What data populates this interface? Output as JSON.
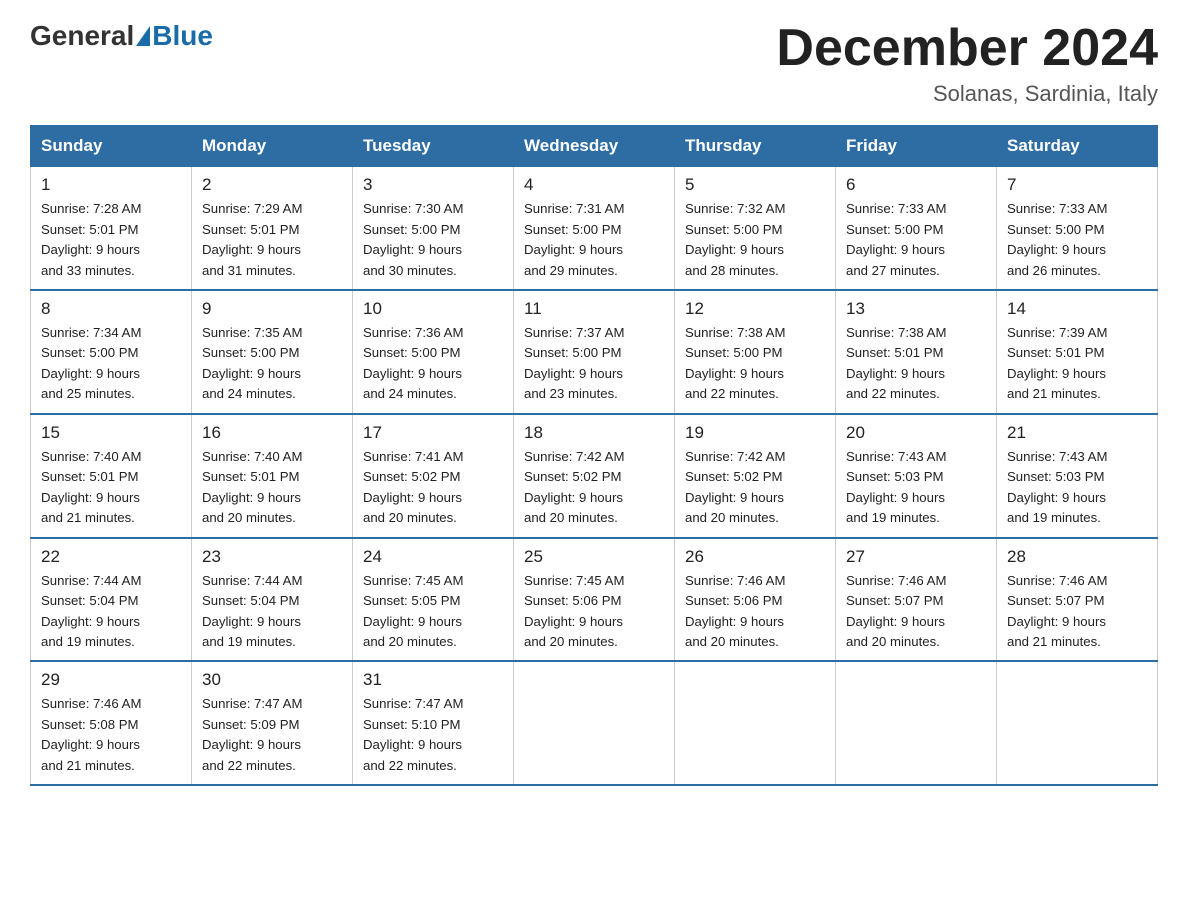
{
  "header": {
    "logo_general": "General",
    "logo_blue": "Blue",
    "month_title": "December 2024",
    "subtitle": "Solanas, Sardinia, Italy"
  },
  "days_of_week": [
    "Sunday",
    "Monday",
    "Tuesday",
    "Wednesday",
    "Thursday",
    "Friday",
    "Saturday"
  ],
  "weeks": [
    [
      {
        "day": "1",
        "sunrise": "7:28 AM",
        "sunset": "5:01 PM",
        "daylight": "9 hours and 33 minutes."
      },
      {
        "day": "2",
        "sunrise": "7:29 AM",
        "sunset": "5:01 PM",
        "daylight": "9 hours and 31 minutes."
      },
      {
        "day": "3",
        "sunrise": "7:30 AM",
        "sunset": "5:00 PM",
        "daylight": "9 hours and 30 minutes."
      },
      {
        "day": "4",
        "sunrise": "7:31 AM",
        "sunset": "5:00 PM",
        "daylight": "9 hours and 29 minutes."
      },
      {
        "day": "5",
        "sunrise": "7:32 AM",
        "sunset": "5:00 PM",
        "daylight": "9 hours and 28 minutes."
      },
      {
        "day": "6",
        "sunrise": "7:33 AM",
        "sunset": "5:00 PM",
        "daylight": "9 hours and 27 minutes."
      },
      {
        "day": "7",
        "sunrise": "7:33 AM",
        "sunset": "5:00 PM",
        "daylight": "9 hours and 26 minutes."
      }
    ],
    [
      {
        "day": "8",
        "sunrise": "7:34 AM",
        "sunset": "5:00 PM",
        "daylight": "9 hours and 25 minutes."
      },
      {
        "day": "9",
        "sunrise": "7:35 AM",
        "sunset": "5:00 PM",
        "daylight": "9 hours and 24 minutes."
      },
      {
        "day": "10",
        "sunrise": "7:36 AM",
        "sunset": "5:00 PM",
        "daylight": "9 hours and 24 minutes."
      },
      {
        "day": "11",
        "sunrise": "7:37 AM",
        "sunset": "5:00 PM",
        "daylight": "9 hours and 23 minutes."
      },
      {
        "day": "12",
        "sunrise": "7:38 AM",
        "sunset": "5:00 PM",
        "daylight": "9 hours and 22 minutes."
      },
      {
        "day": "13",
        "sunrise": "7:38 AM",
        "sunset": "5:01 PM",
        "daylight": "9 hours and 22 minutes."
      },
      {
        "day": "14",
        "sunrise": "7:39 AM",
        "sunset": "5:01 PM",
        "daylight": "9 hours and 21 minutes."
      }
    ],
    [
      {
        "day": "15",
        "sunrise": "7:40 AM",
        "sunset": "5:01 PM",
        "daylight": "9 hours and 21 minutes."
      },
      {
        "day": "16",
        "sunrise": "7:40 AM",
        "sunset": "5:01 PM",
        "daylight": "9 hours and 20 minutes."
      },
      {
        "day": "17",
        "sunrise": "7:41 AM",
        "sunset": "5:02 PM",
        "daylight": "9 hours and 20 minutes."
      },
      {
        "day": "18",
        "sunrise": "7:42 AM",
        "sunset": "5:02 PM",
        "daylight": "9 hours and 20 minutes."
      },
      {
        "day": "19",
        "sunrise": "7:42 AM",
        "sunset": "5:02 PM",
        "daylight": "9 hours and 20 minutes."
      },
      {
        "day": "20",
        "sunrise": "7:43 AM",
        "sunset": "5:03 PM",
        "daylight": "9 hours and 19 minutes."
      },
      {
        "day": "21",
        "sunrise": "7:43 AM",
        "sunset": "5:03 PM",
        "daylight": "9 hours and 19 minutes."
      }
    ],
    [
      {
        "day": "22",
        "sunrise": "7:44 AM",
        "sunset": "5:04 PM",
        "daylight": "9 hours and 19 minutes."
      },
      {
        "day": "23",
        "sunrise": "7:44 AM",
        "sunset": "5:04 PM",
        "daylight": "9 hours and 19 minutes."
      },
      {
        "day": "24",
        "sunrise": "7:45 AM",
        "sunset": "5:05 PM",
        "daylight": "9 hours and 20 minutes."
      },
      {
        "day": "25",
        "sunrise": "7:45 AM",
        "sunset": "5:06 PM",
        "daylight": "9 hours and 20 minutes."
      },
      {
        "day": "26",
        "sunrise": "7:46 AM",
        "sunset": "5:06 PM",
        "daylight": "9 hours and 20 minutes."
      },
      {
        "day": "27",
        "sunrise": "7:46 AM",
        "sunset": "5:07 PM",
        "daylight": "9 hours and 20 minutes."
      },
      {
        "day": "28",
        "sunrise": "7:46 AM",
        "sunset": "5:07 PM",
        "daylight": "9 hours and 21 minutes."
      }
    ],
    [
      {
        "day": "29",
        "sunrise": "7:46 AM",
        "sunset": "5:08 PM",
        "daylight": "9 hours and 21 minutes."
      },
      {
        "day": "30",
        "sunrise": "7:47 AM",
        "sunset": "5:09 PM",
        "daylight": "9 hours and 22 minutes."
      },
      {
        "day": "31",
        "sunrise": "7:47 AM",
        "sunset": "5:10 PM",
        "daylight": "9 hours and 22 minutes."
      },
      null,
      null,
      null,
      null
    ]
  ],
  "labels": {
    "sunrise": "Sunrise:",
    "sunset": "Sunset:",
    "daylight": "Daylight:"
  }
}
